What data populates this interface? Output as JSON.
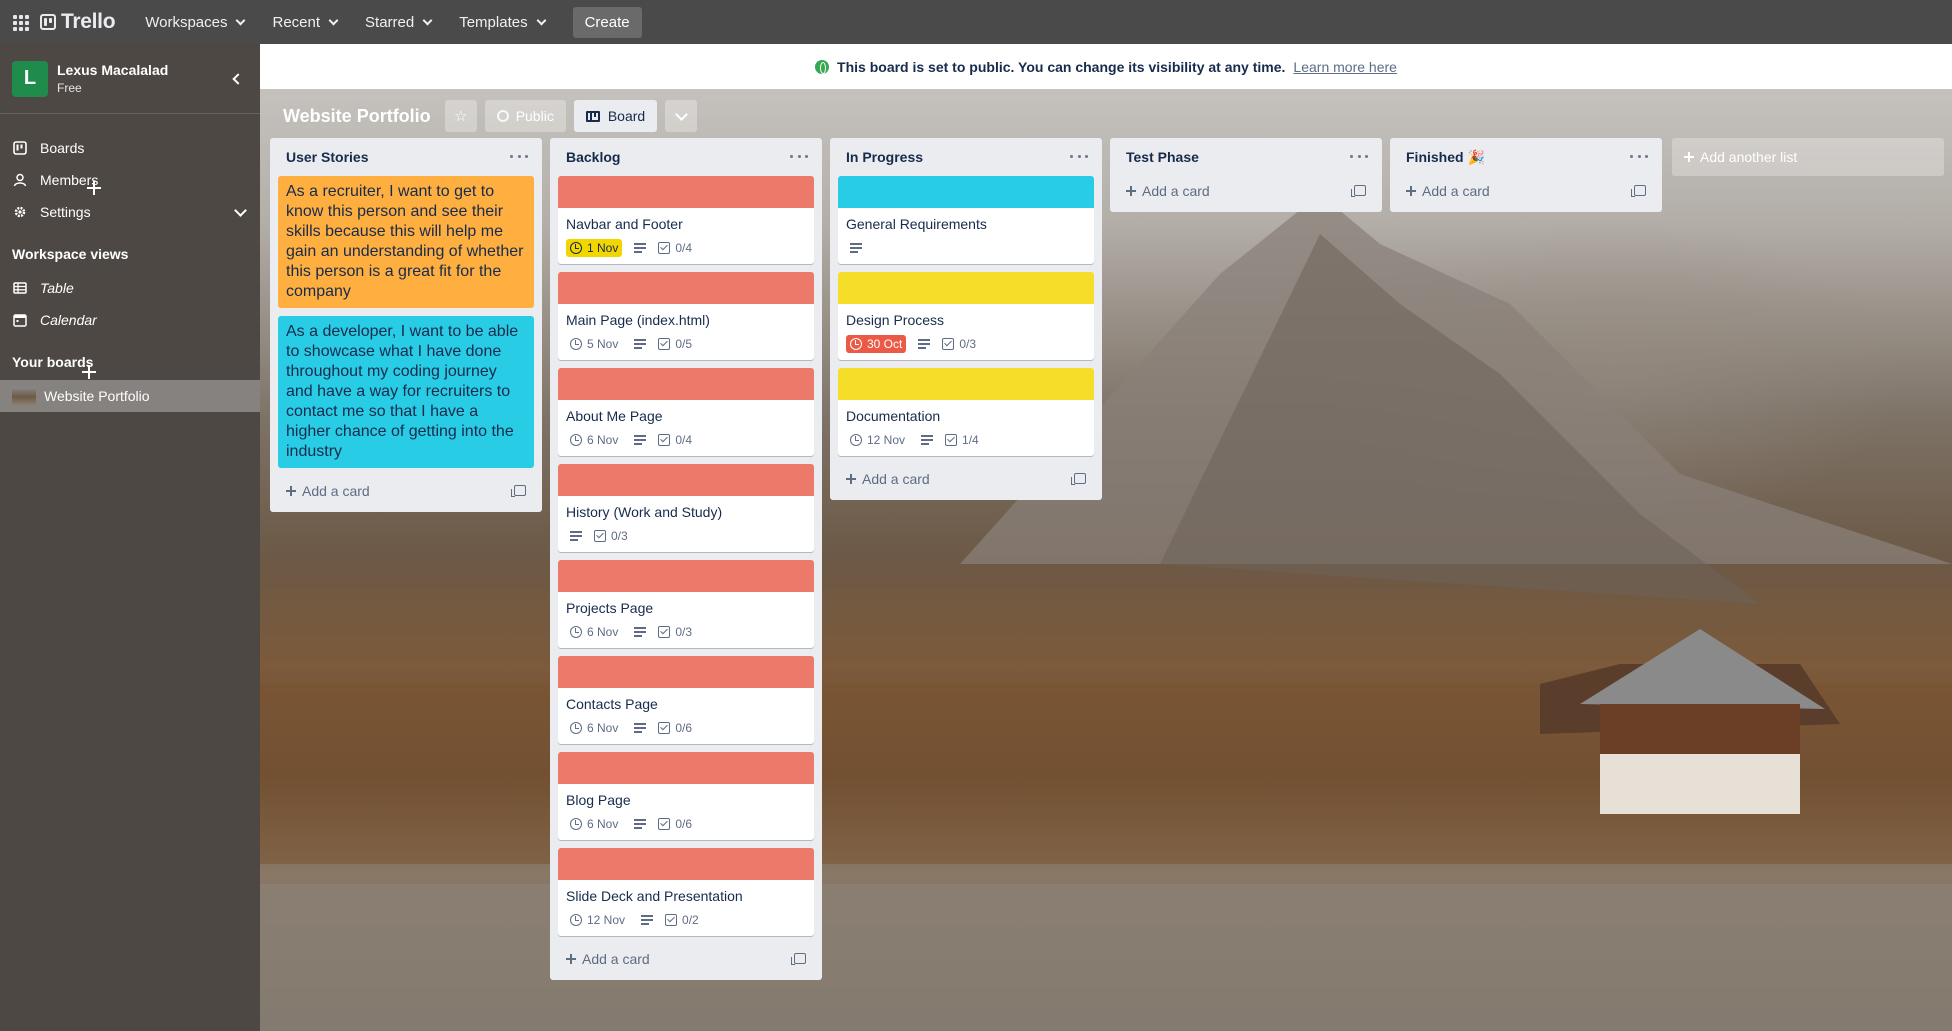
{
  "topbar": {
    "logo": "Trello",
    "nav": [
      "Workspaces",
      "Recent",
      "Starred",
      "Templates"
    ],
    "create": "Create"
  },
  "sidebar": {
    "workspace_initial": "L",
    "workspace_name": "Lexus Macalalad",
    "plan": "Free",
    "items": [
      "Boards",
      "Members",
      "Settings"
    ],
    "views_heading": "Workspace views",
    "views": [
      "Table",
      "Calendar"
    ],
    "boards_heading": "Your boards",
    "boards": [
      "Website Portfolio"
    ]
  },
  "notice": {
    "text": "This board is set to public. You can change its visibility at any time.",
    "link": "Learn more here"
  },
  "board": {
    "title": "Website Portfolio",
    "visibility": "Public",
    "view": "Board"
  },
  "colors": {
    "red": "#eb7a6a",
    "cyan": "#29cce5",
    "yellow": "#f5dd29",
    "orange": "#ffaf3f"
  },
  "lists": [
    {
      "name": "User Stories",
      "stories": [
        {
          "text": "As a recruiter, I want to get to know this person and see their skills because this will help me gain an understanding of whether this person is a great fit for the company",
          "color": "#ffaf3f"
        },
        {
          "text": "As a developer, I want to be able to showcase what I have done throughout my coding journey and have a way for recruiters to contact me so that I have a higher chance of getting into the industry",
          "color": "#29cce5"
        }
      ],
      "add_card": "Add a card"
    },
    {
      "name": "Backlog",
      "cards": [
        {
          "title": "Navbar and Footer",
          "due": "1 Nov",
          "checklist": "0/4"
        },
        {
          "title": "Main Page (index.html)",
          "due": "5 Nov",
          "checklist": "0/5"
        },
        {
          "title": "About Me Page",
          "due": "6 Nov",
          "checklist": "0/4"
        },
        {
          "title": "History (Work and Study)",
          "due": "",
          "checklist": "0/3"
        },
        {
          "title": "Projects Page",
          "due": "6 Nov",
          "checklist": "0/3"
        },
        {
          "title": "Contacts Page",
          "due": "6 Nov",
          "checklist": "0/6"
        },
        {
          "title": "Blog Page",
          "due": "6 Nov",
          "checklist": "0/6"
        },
        {
          "title": "Slide Deck and Presentation",
          "due": "12 Nov",
          "checklist": "0/2"
        }
      ],
      "add_card": "Add a card"
    },
    {
      "name": "In Progress",
      "cards": [
        {
          "title": "General Requirements",
          "due": "",
          "checklist": ""
        },
        {
          "title": "Design Process",
          "due": "30 Oct",
          "checklist": "0/3"
        },
        {
          "title": "Documentation",
          "due": "12 Nov",
          "checklist": "1/4"
        }
      ],
      "add_card": "Add a card"
    },
    {
      "name": "Test Phase",
      "add_card": "Add a card"
    },
    {
      "name": "Finished 🎉",
      "add_card": "Add a card"
    }
  ],
  "add_list": "Add another list"
}
